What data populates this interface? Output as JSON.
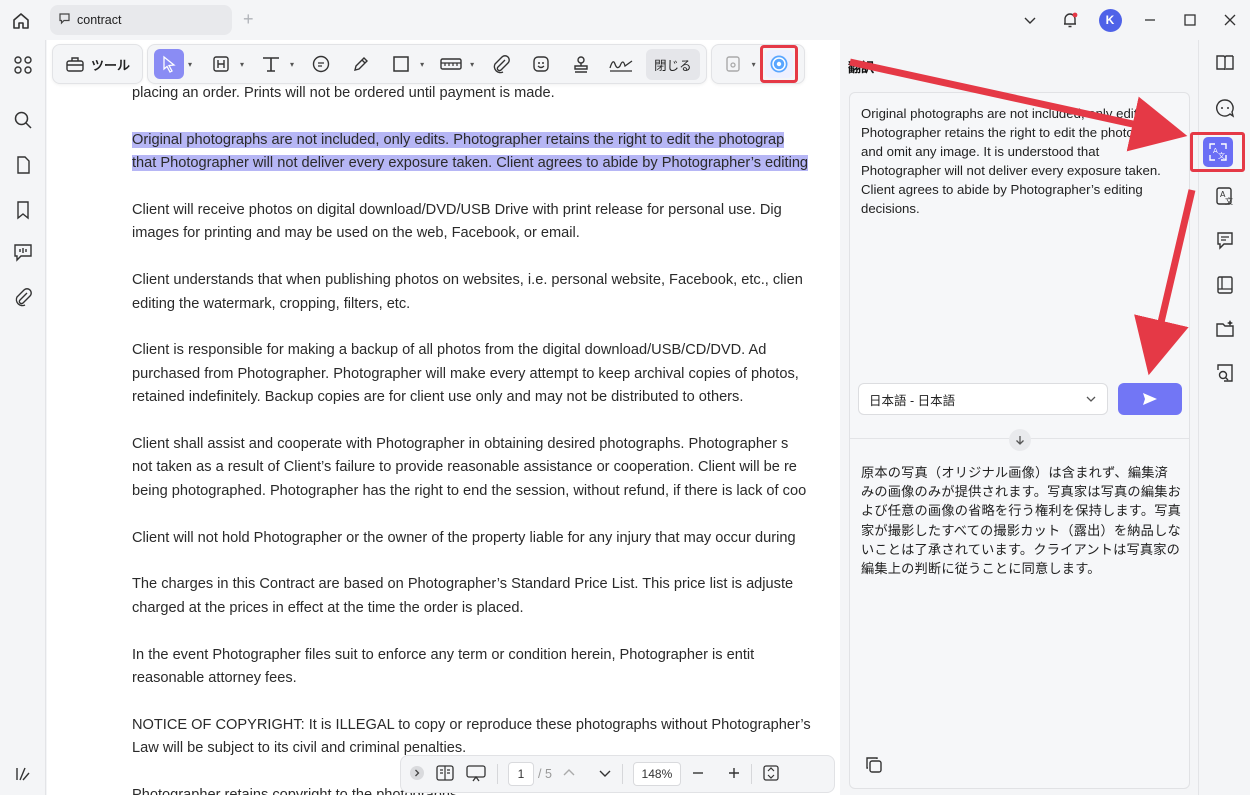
{
  "window": {
    "tab_title": "contract",
    "avatar_letter": "K"
  },
  "toolbar": {
    "tools_label": "ツール",
    "close_label": "閉じる",
    "accent": "#8a8cf4"
  },
  "document": {
    "paragraphs": [
      {
        "lines": [
          "placing an order. Prints will not be ordered until payment is made."
        ],
        "highlight": false
      },
      {
        "lines": [
          "Original photographs are not included, only edits. Photographer retains the right to edit the photograp",
          "that Photographer will not deliver every exposure taken. Client agrees to abide by Photographer’s editing"
        ],
        "highlight": true
      },
      {
        "lines": [
          "Client will receive photos on digital download/DVD/USB Drive with print release for personal use. Dig",
          "images for printing and may be used on the web, Facebook, or email."
        ],
        "highlight": false
      },
      {
        "lines": [
          "Client understands that when publishing photos on websites, i.e. personal website, Facebook, etc., clien",
          "editing the watermark, cropping, filters, etc."
        ],
        "highlight": false
      },
      {
        "lines": [
          "Client is responsible for making a backup of all photos from the digital download/USB/CD/DVD. Ad",
          "purchased from Photographer. Photographer will make every attempt to keep archival copies of photos,",
          "retained indefinitely. Backup copies are for client use only and may not be distributed to others."
        ],
        "highlight": false
      },
      {
        "lines": [
          "Client shall assist and cooperate with Photographer in obtaining desired photographs. Photographer s",
          "not taken as a result of Client’s failure to provide reasonable assistance or cooperation. Client will be re",
          "being photographed. Photographer has the right to end the session, without refund, if there is lack of coo"
        ],
        "highlight": false
      },
      {
        "lines": [
          "Client will not hold Photographer or the owner of the property liable for any injury that may occur during"
        ],
        "highlight": false
      },
      {
        "lines": [
          "The charges in this Contract are based on Photographer’s Standard Price List. This price list is adjuste",
          "charged at the prices in effect at the time the order is placed."
        ],
        "highlight": false
      },
      {
        "lines": [
          "In the event Photographer files suit to enforce any term or condition herein, Photographer is entit",
          "reasonable attorney fees."
        ],
        "highlight": false
      },
      {
        "lines": [
          "NOTICE OF COPYRIGHT: It is ILLEGAL to copy or reproduce these photographs without Photographer’s",
          "Law will be subject to its civil and criminal penalties."
        ],
        "highlight": false
      },
      {
        "lines": [
          "Photographer retains copyright to the photographs..."
        ],
        "highlight": false
      }
    ],
    "highlight_color": "#b6b6f5"
  },
  "bottombar": {
    "page_current": "1",
    "page_total": "/ 5",
    "zoom": "148%"
  },
  "panel": {
    "title": "翻訳",
    "source_text": "Original photographs are not included, only edits. Photographer retains the right to edit the photographs and omit any image. It is understood that Photographer will not deliver every exposure taken. Client agrees to abide by Photographer’s editing decisions.",
    "language": "日本語 - 日本語",
    "result_text": "原本の写真（オリジナル画像）は含まれず、編集済みの画像のみが提供されます。写真家は写真の編集および任意の画像の省略を行う権利を保持します。写真家が撮影したすべての撮影カット（露出）を納品しないことは了承されています。クライアントは写真家の編集上の判断に従うことに同意します。",
    "send_color": "#7276f5"
  },
  "annotation": {
    "arrow_color": "#e53946"
  }
}
